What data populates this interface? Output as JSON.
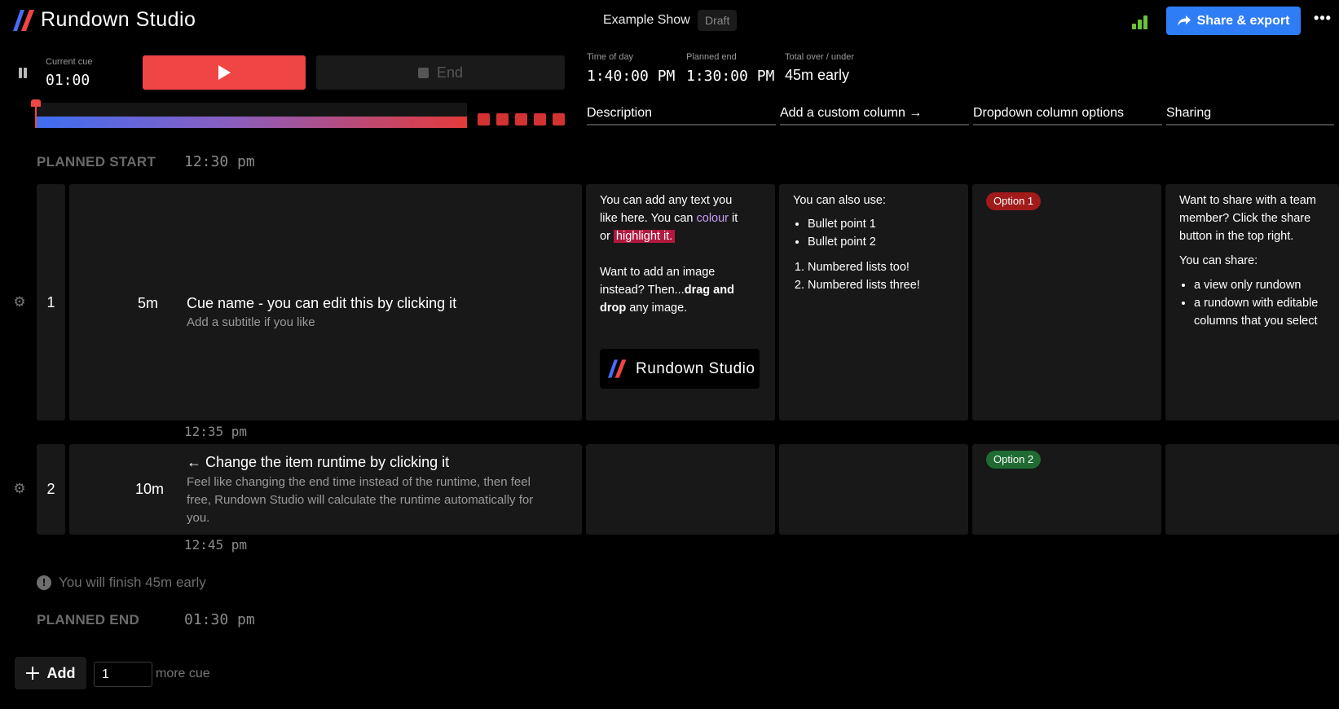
{
  "header": {
    "app_title": "Rundown Studio",
    "show_name": "Example Show",
    "status_badge": "Draft",
    "share_label": "Share & export",
    "more_label": "•••"
  },
  "controls": {
    "current_cue_label": "Current cue",
    "current_cue_time": "01:00",
    "end_label": "End",
    "time_of_day_label": "Time of day",
    "time_of_day": "1:40:00 PM",
    "planned_end_label": "Planned end",
    "planned_end": "1:30:00 PM",
    "over_under_label": "Total over / under",
    "over_under": "45m early"
  },
  "columns": [
    "Description",
    "Add a custom column →",
    "Dropdown column options",
    "Sharing"
  ],
  "planned_start": {
    "label": "PLANNED START",
    "time": "12:30 pm"
  },
  "planned_end": {
    "label": "PLANNED END",
    "time": "01:30 pm"
  },
  "cues": [
    {
      "number": "1",
      "runtime": "5m",
      "title": "Cue name - you can edit this by clicking it",
      "subtitle": "Add a subtitle if you like",
      "end_time": "12:35 pm",
      "description": {
        "line1a": "You can add any text you",
        "line1b": "like here. You can ",
        "colour_word": "colour",
        "line1c": " it",
        "or_word": "or ",
        "highlight": "highlight it.",
        "line2a": "Want to add an image",
        "line2b": "instead? Then...",
        "bold1": "drag and",
        "bold2": "drop",
        "line2c": " any image.",
        "image_logo_text": "Rundown Studio"
      },
      "custom_col": {
        "intro": "You can also use:",
        "bullets": [
          "Bullet point 1",
          "Bullet point 2"
        ],
        "numbered": [
          "Numbered lists too!",
          "Numbered lists three!"
        ]
      },
      "dropdown": "Option 1",
      "sharing": {
        "line1": "Want to share with a team",
        "line2": "member? Click the share",
        "line3": "button in the top right.",
        "line4": "You can share:",
        "bullets": [
          "a view only rundown",
          "a rundown with editable",
          "columns that you select"
        ]
      }
    },
    {
      "number": "2",
      "runtime": "10m",
      "title": "← Change the item runtime by clicking it",
      "subtitle_lines": [
        "Feel like changing the end time instead of the runtime, then feel",
        "free, Rundown Studio will calculate the runtime automatically for",
        "you."
      ],
      "end_time": "12:45 pm",
      "dropdown": "Option 2"
    }
  ],
  "finish_note": "You will finish 45m early",
  "footer": {
    "add_label": "Add",
    "count_value": "1",
    "more_cue_label": "more cue"
  },
  "colors": {
    "accent_blue": "#2f7df6",
    "play_red": "#ef4545",
    "option1": "#a11b1b",
    "option2": "#1f6b32",
    "signal_green": "#6cc33a"
  },
  "icons": [
    "logo-icon",
    "signal-icon",
    "share-icon",
    "more-icon",
    "pause-icon",
    "play-icon",
    "stop-icon",
    "gear-icon",
    "info-icon",
    "plus-icon"
  ],
  "progress": {
    "elapsed_fraction": 1.0
  }
}
